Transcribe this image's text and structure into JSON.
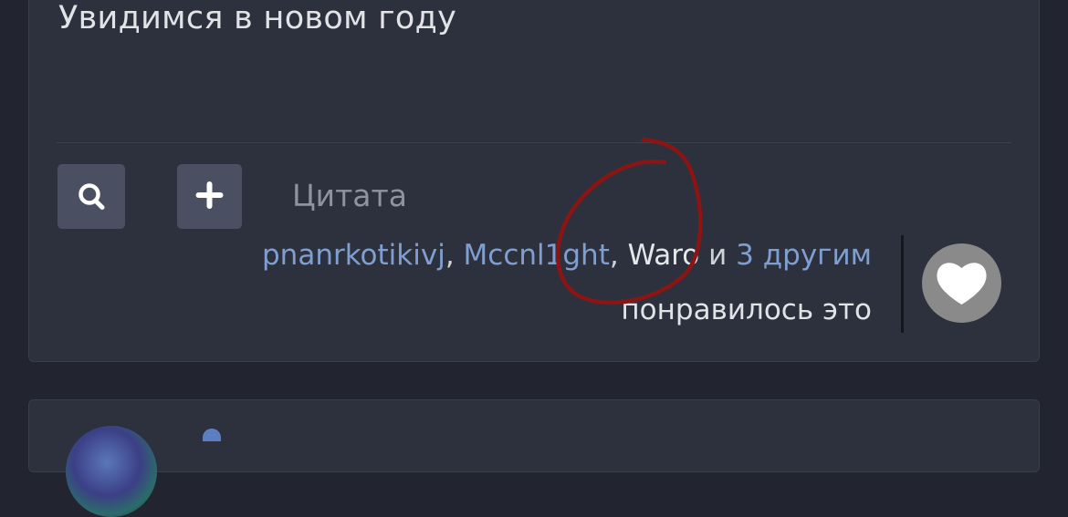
{
  "post": {
    "text": "Увидимся в новом году",
    "quote_label": "Цитата",
    "likes": {
      "users": [
        "pnanrkotikivj",
        "Mccnl1ght",
        "Waro"
      ],
      "separator": ", ",
      "conjunction": " и ",
      "others_link": "3 другим",
      "suffix": "понравилось это"
    }
  },
  "icons": {
    "search": "search-icon",
    "add": "plus-icon",
    "like": "heart-icon"
  },
  "colors": {
    "link": "#7f9fd1",
    "annotation": "#8b1414"
  }
}
